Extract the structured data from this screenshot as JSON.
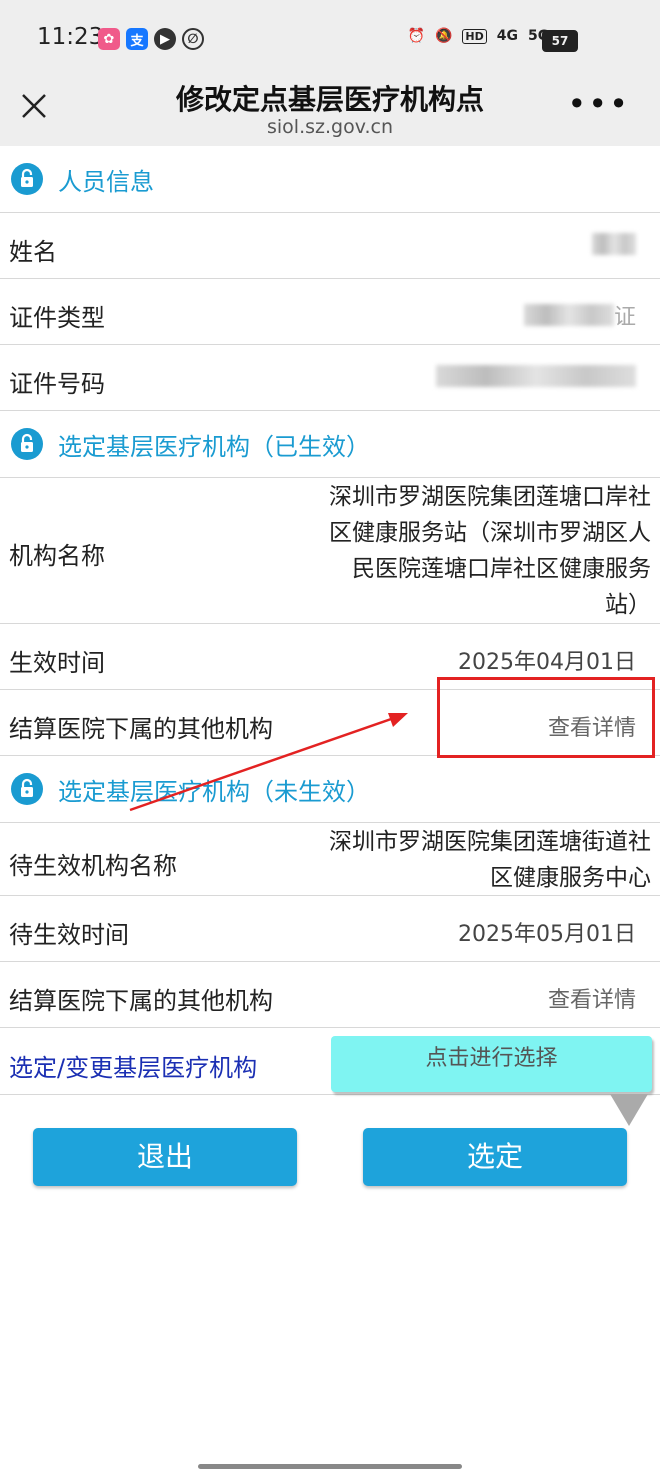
{
  "status_bar": {
    "time": "11:23",
    "icons": [
      "app-icon-1",
      "alipay-icon",
      "video-icon",
      "link-icon",
      "alarm-icon",
      "mute-icon",
      "hd-icon",
      "4g-icon",
      "5g-icon",
      "wifi-icon",
      "battery-icon"
    ],
    "network_1": "4G",
    "network_2": "5G",
    "hd": "HD",
    "battery": "57"
  },
  "titlebar": {
    "title": "修改定点基层医疗机构点",
    "url": "siol.sz.gov.cn",
    "more": "•••"
  },
  "sections": {
    "personal": "人员信息",
    "effective": "选定基层医疗机构（已生效）",
    "pending": "选定基层医疗机构（未生效）"
  },
  "personal": {
    "name_label": "姓名",
    "id_type_label": "证件类型",
    "id_type_value_visible": "证",
    "id_number_label": "证件号码"
  },
  "effective": {
    "org_label": "机构名称",
    "org_value": "深圳市罗湖医院集团莲塘口岸社区健康服务站（深圳市罗湖区人民医院莲塘口岸社区健康服务站）",
    "time_label": "生效时间",
    "time_value": "2025年04月01日",
    "other_label": "结算医院下属的其他机构",
    "other_link": "查看详情"
  },
  "pending": {
    "org_label": "待生效机构名称",
    "org_value": "深圳市罗湖医院集团莲塘街道社区健康服务中心",
    "time_label": "待生效时间",
    "time_value": "2025年05月01日",
    "other_label": "结算医院下属的其他机构",
    "other_link": "查看详情"
  },
  "selection": {
    "label": "选定/变更基层医疗机构",
    "button": "点击进行选择"
  },
  "actions": {
    "exit": "退出",
    "confirm": "选定"
  },
  "colors": {
    "accent": "#1a9bd1",
    "primary_button": "#1ea3db",
    "select_button": "#7ff4f2",
    "link_label": "#1b2fb3",
    "annotation": "#e32222"
  }
}
